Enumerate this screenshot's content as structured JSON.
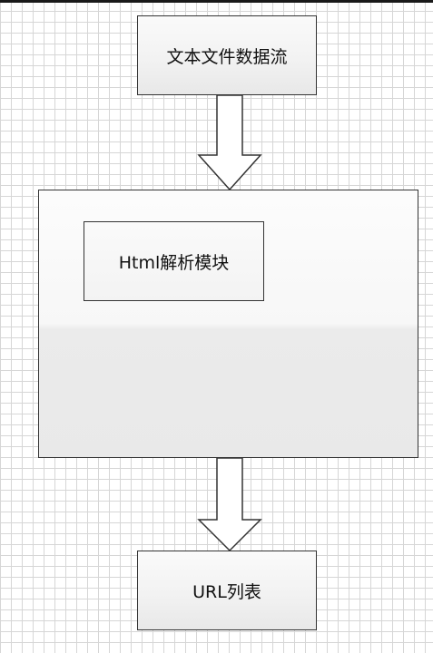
{
  "diagram": {
    "nodes": {
      "source": "文本文件数据流",
      "module": "Html解析模块",
      "output": "URL列表"
    },
    "edges": [
      {
        "from": "source",
        "to": "container"
      },
      {
        "from": "container",
        "to": "output"
      }
    ],
    "colors": {
      "stroke": "#333333",
      "grid": "#d6d6d6",
      "arrow_fill": "#ffffff"
    }
  }
}
